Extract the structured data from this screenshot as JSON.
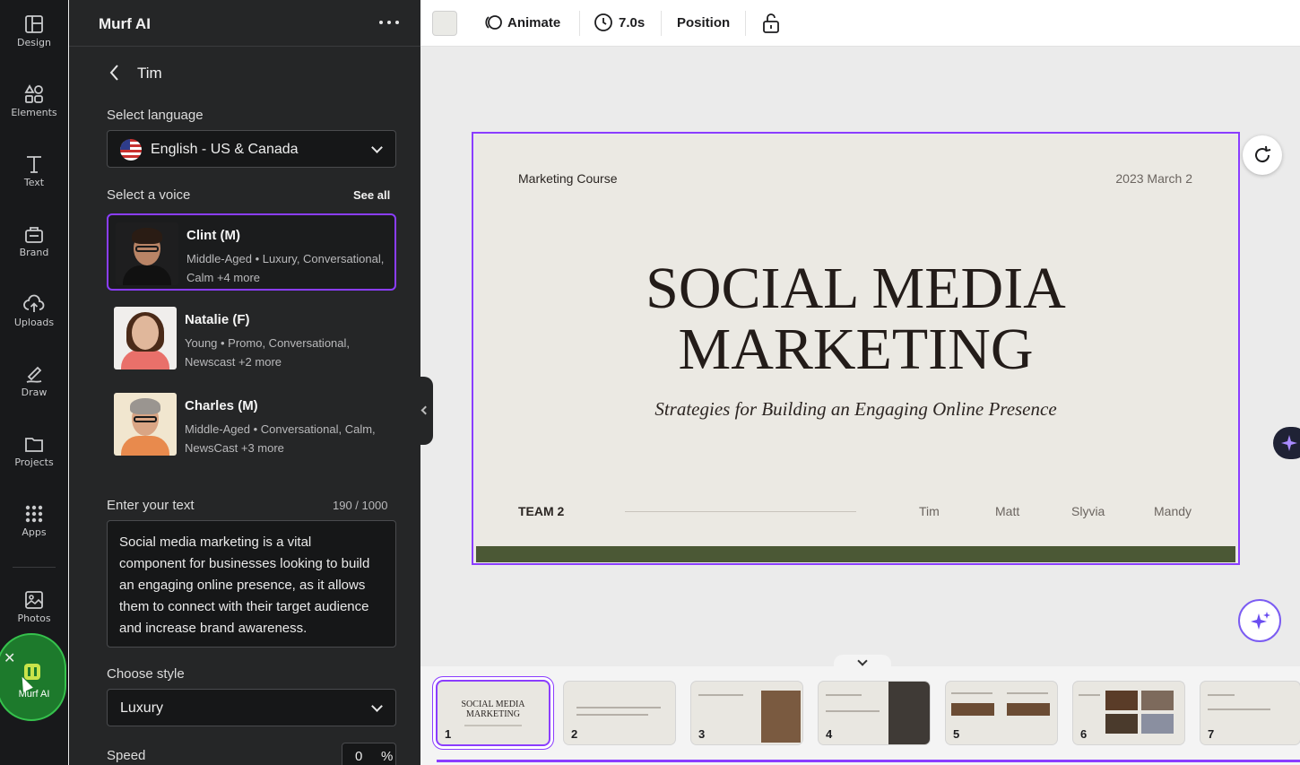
{
  "rail": {
    "items": [
      {
        "label": "Design",
        "icon": "layout-icon"
      },
      {
        "label": "Elements",
        "icon": "shapes-icon"
      },
      {
        "label": "Text",
        "icon": "text-icon"
      },
      {
        "label": "Brand",
        "icon": "brand-icon"
      },
      {
        "label": "Uploads",
        "icon": "cloud-upload-icon"
      },
      {
        "label": "Draw",
        "icon": "pen-icon"
      },
      {
        "label": "Projects",
        "icon": "folder-icon"
      },
      {
        "label": "Apps",
        "icon": "apps-grid-icon"
      },
      {
        "label": "Photos",
        "icon": "image-icon"
      }
    ],
    "active_app": {
      "label": "Murf AI",
      "close": "✕"
    }
  },
  "panel": {
    "title": "Murf AI",
    "voice_name": "Tim",
    "language_label": "Select language",
    "language_value": "English - US & Canada",
    "voice_label": "Select a voice",
    "see_all": "See all",
    "voices": [
      {
        "name": "Clint (M)",
        "desc": "Middle-Aged • Luxury, Conversational, Calm +4 more",
        "selected": true
      },
      {
        "name": "Natalie (F)",
        "desc": "Young • Promo, Conversational, Newscast +2 more",
        "selected": false
      },
      {
        "name": "Charles (M)",
        "desc": "Middle-Aged • Conversational, Calm, NewsCast +3 more",
        "selected": false
      }
    ],
    "text_label": "Enter your text",
    "text_counter": "190 / 1000",
    "text_value": "Social media marketing is a vital component for businesses looking to build an engaging online presence, as it allows them to connect with their target audience and increase brand awareness.",
    "style_label": "Choose style",
    "style_value": "Luxury",
    "speed_label": "Speed",
    "speed_value": "0",
    "speed_unit": "%"
  },
  "toolbar": {
    "animate": "Animate",
    "duration": "7.0s",
    "position": "Position"
  },
  "slide": {
    "course": "Marketing Course",
    "date": "2023 March 2",
    "title_line1": "SOCIAL MEDIA",
    "title_line2": "MARKETING",
    "subtitle": "Strategies for Building an Engaging Online Presence",
    "team": "TEAM 2",
    "members": [
      "Tim",
      "Matt",
      "Slyvia",
      "Mandy"
    ]
  },
  "pages": {
    "thumbs": [
      "1",
      "2",
      "3",
      "4",
      "5",
      "6",
      "7"
    ],
    "thumb1_title": "SOCIAL MEDIA MARKETING",
    "active": 1
  },
  "colors": {
    "accent": "#8b3dff",
    "panel_bg": "#252627",
    "rail_bg": "#18191b",
    "slide_bg": "#ebe9e3",
    "slide_bar": "#4b5835",
    "murf_green": "#1d7a2c"
  }
}
